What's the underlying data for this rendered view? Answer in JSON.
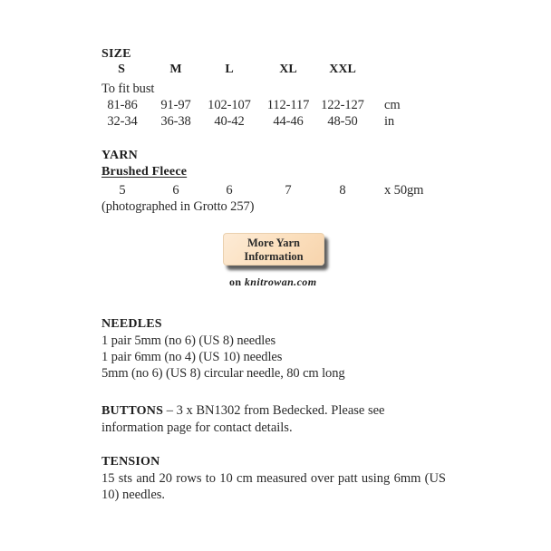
{
  "size": {
    "heading": "SIZE",
    "columns": [
      "S",
      "M",
      "L",
      "XL",
      "XXL"
    ],
    "fit_label": "To fit bust",
    "rows": [
      {
        "values": [
          "81-86",
          "91-97",
          "102-107",
          "112-117",
          "122-127"
        ],
        "unit": "cm"
      },
      {
        "values": [
          "32-34",
          "36-38",
          "40-42",
          "44-46",
          "48-50"
        ],
        "unit": "in"
      }
    ]
  },
  "yarn": {
    "heading": "YARN",
    "name": "Brushed Fleece",
    "quantities": [
      "5",
      "6",
      "6",
      "7",
      "8"
    ],
    "unit": "x 50gm",
    "note": "(photographed in Grotto 257)",
    "button": {
      "line1": "More Yarn",
      "line2": "Information"
    },
    "link_prefix": "on",
    "link_text": "knitrowan.com"
  },
  "needles": {
    "heading": "NEEDLES",
    "items": [
      "1 pair 5mm (no 6) (US 8) needles",
      "1 pair 6mm (no 4) (US 10) needles",
      "5mm (no 6) (US 8) circular needle, 80 cm long"
    ]
  },
  "buttons": {
    "heading": "BUTTONS",
    "text": " – 3 x BN1302 from Bedecked. Please see information page for contact details."
  },
  "tension": {
    "heading": "TENSION",
    "text": "15 sts and 20 rows to 10 cm measured over patt using 6mm (US 10) needles."
  },
  "colors": {
    "text": "#2a2a2a",
    "button_bg": "#fbdfbd",
    "background": "#ffffff"
  }
}
